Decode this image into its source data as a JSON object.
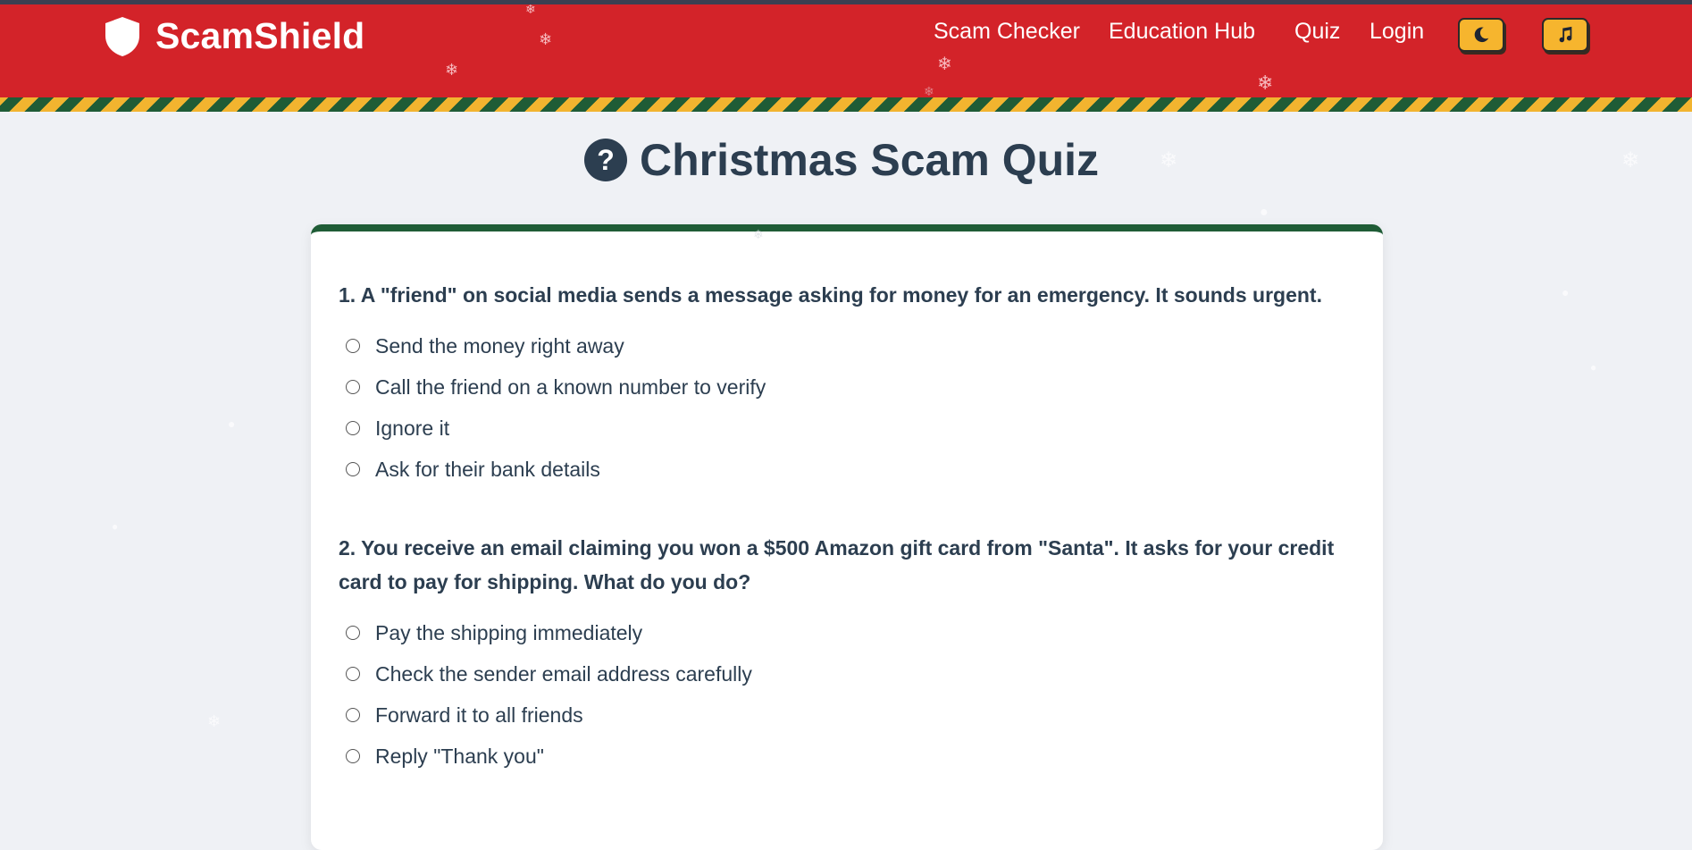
{
  "header": {
    "brand": "ScamShield",
    "nav": [
      "Scam Checker",
      "Education Hub",
      "Quiz",
      "Login"
    ],
    "dark_mode_icon": "moon-icon",
    "music_icon": "music-note-icon"
  },
  "colors": {
    "header_red": "#d32329",
    "accent_gold": "#f6b52e",
    "stripe_green": "#1f5c36",
    "text_dark": "#2c3e50"
  },
  "page": {
    "title_icon": "?",
    "title": "Christmas Scam Quiz"
  },
  "quiz": {
    "questions": [
      {
        "text": "1. A \"friend\" on social media sends a message asking for money for an emergency. It sounds urgent.",
        "options": [
          "Send the money right away",
          "Call the friend on a known number to verify",
          "Ignore it",
          "Ask for their bank details"
        ]
      },
      {
        "text": "2. You receive an email claiming you won a $500 Amazon gift card from \"Santa\". It asks for your credit card to pay for shipping. What do you do?",
        "options": [
          "Pay the shipping immediately",
          "Check the sender email address carefully",
          "Forward it to all friends",
          "Reply \"Thank you\""
        ]
      }
    ]
  }
}
